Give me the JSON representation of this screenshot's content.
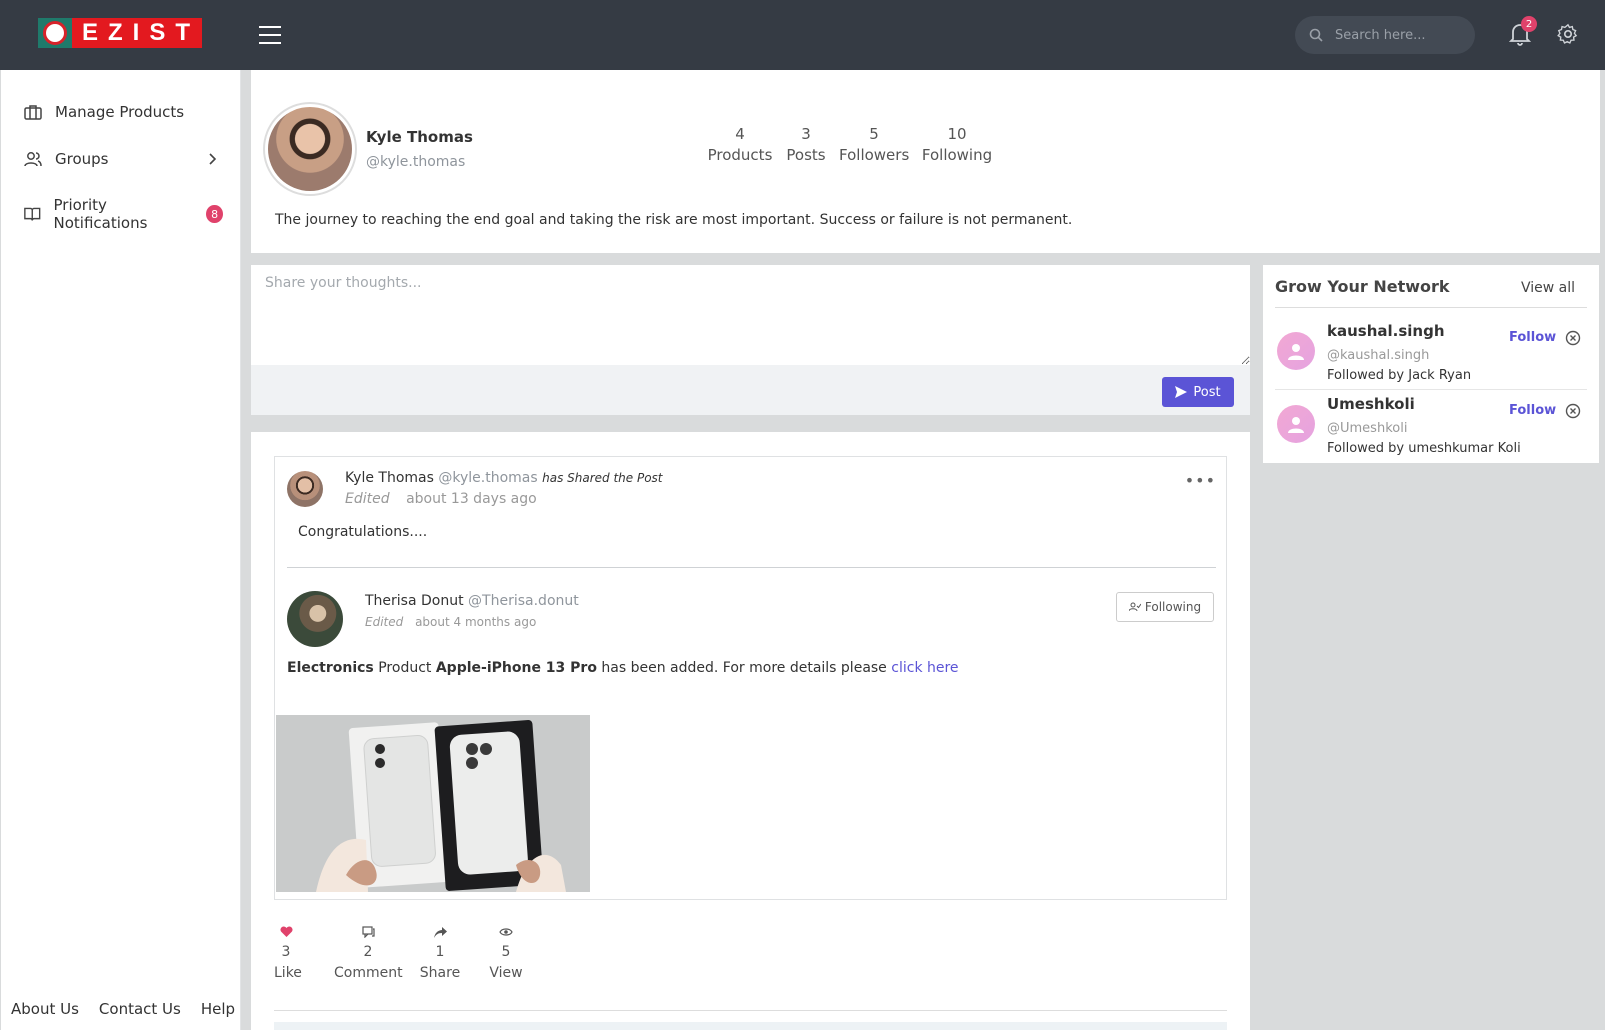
{
  "brand": {
    "logo_text": "EZIST",
    "logo_badge_text": "EZIST"
  },
  "header": {
    "search_placeholder": "Search here...",
    "notification_count": "2"
  },
  "sidebar": {
    "items": [
      {
        "label": "Manage Products",
        "icon": "briefcase-icon"
      },
      {
        "label": "Groups",
        "icon": "users-icon"
      },
      {
        "label": "Priority Notifications",
        "icon": "book-icon",
        "badge": "8"
      }
    ],
    "footer": [
      "About Us",
      "Contact Us",
      "Help"
    ]
  },
  "profile": {
    "name": "Kyle Thomas",
    "handle": "@kyle.thomas",
    "stats": [
      {
        "value": "4",
        "label": "Products"
      },
      {
        "value": "3",
        "label": "Posts"
      },
      {
        "value": "5",
        "label": "Followers"
      },
      {
        "value": "10",
        "label": "Following"
      }
    ],
    "bio": "The journey to reaching the end goal and taking the risk are most important. Success or failure is not permanent."
  },
  "composer": {
    "placeholder": "Share your thoughts...",
    "post_label": "Post"
  },
  "network": {
    "title": "Grow Your Network",
    "view_all": "View all",
    "suggestions": [
      {
        "name": "kaushal.singh",
        "handle": "@kaushal.singh",
        "followed_by": "Followed by Jack Ryan",
        "action": "Follow"
      },
      {
        "name": "Umeshkoli",
        "handle": "@Umeshkoli",
        "followed_by": "Followed by umeshkumar Koli",
        "action": "Follow"
      }
    ]
  },
  "feed": {
    "shared_post": {
      "author": "Kyle Thomas",
      "handle": "@kyle.thomas",
      "action_text": "has Shared the Post",
      "edited": "Edited",
      "time": "about 13 days ago",
      "text": "Congratulations....",
      "original": {
        "author": "Therisa Donut",
        "handle": "@Therisa.donut",
        "edited": "Edited",
        "time": "about 4 months ago",
        "following_label": "Following",
        "text_category": "Electronics",
        "text_product_word": "Product",
        "text_product": "Apple-iPhone 13 Pro",
        "text_rest": "has been added. For more details please",
        "text_link": "click here"
      }
    },
    "actions": [
      {
        "count": "3",
        "label": "Like",
        "icon": "heart-icon"
      },
      {
        "count": "2",
        "label": "Comment",
        "icon": "comment-icon"
      },
      {
        "count": "1",
        "label": "Share",
        "icon": "share-icon"
      },
      {
        "count": "5",
        "label": "View",
        "icon": "eye-icon"
      }
    ]
  },
  "colors": {
    "topbar": "#353b44",
    "accent": "#5b54d6",
    "badge": "#e0426b",
    "like": "#e0426b"
  }
}
